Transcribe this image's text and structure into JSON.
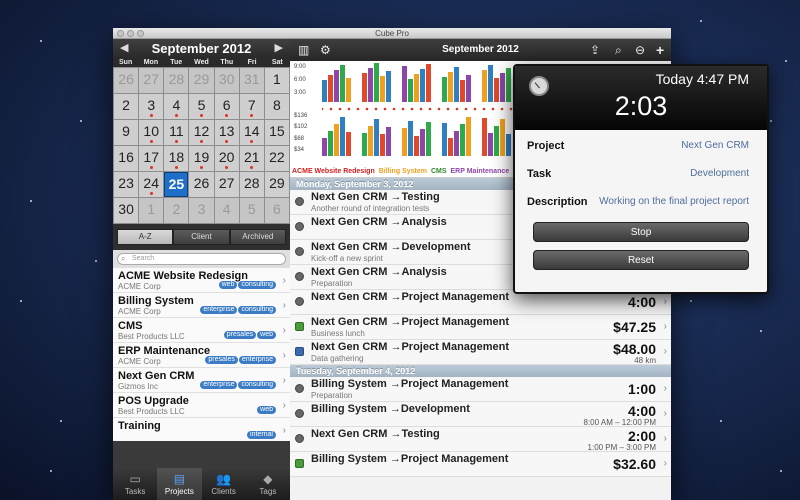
{
  "window": {
    "title": "Cube Pro"
  },
  "calendar": {
    "month": "September 2012",
    "prev_icon": "chevron-left-icon",
    "next_icon": "chevron-right-icon",
    "dows": [
      "Sun",
      "Mon",
      "Tue",
      "Wed",
      "Thu",
      "Fri",
      "Sat"
    ],
    "days": [
      {
        "d": "26",
        "dim": true,
        "dot": false
      },
      {
        "d": "27",
        "dim": true,
        "dot": false
      },
      {
        "d": "28",
        "dim": true,
        "dot": false
      },
      {
        "d": "29",
        "dim": true,
        "dot": false
      },
      {
        "d": "30",
        "dim": true,
        "dot": false
      },
      {
        "d": "31",
        "dim": true,
        "dot": false
      },
      {
        "d": "1",
        "dim": false,
        "dot": false
      },
      {
        "d": "2",
        "dim": false,
        "dot": false
      },
      {
        "d": "3",
        "dim": false,
        "dot": true
      },
      {
        "d": "4",
        "dim": false,
        "dot": true
      },
      {
        "d": "5",
        "dim": false,
        "dot": true
      },
      {
        "d": "6",
        "dim": false,
        "dot": true
      },
      {
        "d": "7",
        "dim": false,
        "dot": true
      },
      {
        "d": "8",
        "dim": false,
        "dot": false
      },
      {
        "d": "9",
        "dim": false,
        "dot": false
      },
      {
        "d": "10",
        "dim": false,
        "dot": true
      },
      {
        "d": "11",
        "dim": false,
        "dot": true
      },
      {
        "d": "12",
        "dim": false,
        "dot": true
      },
      {
        "d": "13",
        "dim": false,
        "dot": true
      },
      {
        "d": "14",
        "dim": false,
        "dot": true
      },
      {
        "d": "15",
        "dim": false,
        "dot": false
      },
      {
        "d": "16",
        "dim": false,
        "dot": false
      },
      {
        "d": "17",
        "dim": false,
        "dot": true
      },
      {
        "d": "18",
        "dim": false,
        "dot": true
      },
      {
        "d": "19",
        "dim": false,
        "dot": true
      },
      {
        "d": "20",
        "dim": false,
        "dot": true
      },
      {
        "d": "21",
        "dim": false,
        "dot": true
      },
      {
        "d": "22",
        "dim": false,
        "dot": false
      },
      {
        "d": "23",
        "dim": false,
        "dot": false
      },
      {
        "d": "24",
        "dim": false,
        "dot": true
      },
      {
        "d": "25",
        "dim": false,
        "dot": false,
        "selected": true
      },
      {
        "d": "26",
        "dim": false,
        "dot": false
      },
      {
        "d": "27",
        "dim": false,
        "dot": false
      },
      {
        "d": "28",
        "dim": false,
        "dot": false
      },
      {
        "d": "29",
        "dim": false,
        "dot": false
      },
      {
        "d": "30",
        "dim": false,
        "dot": false
      },
      {
        "d": "1",
        "dim": true,
        "dot": false
      },
      {
        "d": "2",
        "dim": true,
        "dot": false
      },
      {
        "d": "3",
        "dim": true,
        "dot": false
      },
      {
        "d": "4",
        "dim": true,
        "dot": false
      },
      {
        "d": "5",
        "dim": true,
        "dot": false
      },
      {
        "d": "6",
        "dim": true,
        "dot": false
      }
    ]
  },
  "segments": [
    "A-Z",
    "Client",
    "Archived"
  ],
  "search": {
    "placeholder": "Search"
  },
  "projects": [
    {
      "name": "ACME Website Redesign",
      "client": "ACME Corp",
      "tags": [
        "web",
        "consulting"
      ]
    },
    {
      "name": "Billing System",
      "client": "ACME Corp",
      "tags": [
        "enterprise",
        "consulting"
      ]
    },
    {
      "name": "CMS",
      "client": "Best Products LLC",
      "tags": [
        "presales",
        "web"
      ]
    },
    {
      "name": "ERP Maintenance",
      "client": "ACME Corp",
      "tags": [
        "presales",
        "enterprise"
      ]
    },
    {
      "name": "Next Gen CRM",
      "client": "Gizmos Inc",
      "tags": [
        "enterprise",
        "consulting"
      ]
    },
    {
      "name": "POS Upgrade",
      "client": "Best Products LLC",
      "tags": [
        "web"
      ]
    },
    {
      "name": "Training",
      "client": "",
      "tags": [
        "internal"
      ]
    }
  ],
  "tabs": [
    {
      "label": "Tasks",
      "icon": "tray-icon"
    },
    {
      "label": "Projects",
      "icon": "folder-icon",
      "active": true
    },
    {
      "label": "Clients",
      "icon": "people-icon"
    },
    {
      "label": "Tags",
      "icon": "tag-icon"
    }
  ],
  "toolbar": {
    "title": "September 2012"
  },
  "chart_data": {
    "type": "bar",
    "title": "",
    "series_colors": [
      "#2f7fc1",
      "#e04a2a",
      "#8d47a7",
      "#2eaa4a",
      "#f0a020"
    ],
    "time_axis": {
      "ticks": [
        "9:00",
        "6:00",
        "3:00"
      ]
    },
    "money_axis": {
      "ticks": [
        "$136",
        "$102",
        "$68",
        "$34"
      ]
    },
    "legend": [
      {
        "name": "ACME Website Redesign",
        "color": "#d02020"
      },
      {
        "name": "Billing System",
        "color": "#f0a020"
      },
      {
        "name": "CMS",
        "color": "#2e8a2e"
      },
      {
        "name": "ERP Maintenance",
        "color": "#8d47a7"
      }
    ]
  },
  "sections": [
    {
      "date": "Monday, September 3, 2012",
      "entries": [
        {
          "title": "Next Gen CRM →Testing",
          "sub": "Another round of integration tests",
          "value": "",
          "value_sub": "",
          "kind": "time"
        },
        {
          "title": "Next Gen CRM →Analysis",
          "sub": "",
          "value": "",
          "value_sub": "",
          "kind": "time"
        },
        {
          "title": "Next Gen CRM →Development",
          "sub": "Kick-off a new sprint",
          "value": "",
          "value_sub": "",
          "kind": "time"
        },
        {
          "title": "Next Gen CRM →Analysis",
          "sub": "Preparation",
          "value": "",
          "value_sub": "",
          "kind": "time"
        },
        {
          "title": "Next Gen CRM →Project Management",
          "sub": "",
          "value": "4:00",
          "value_sub": "",
          "kind": "time"
        },
        {
          "title": "Next Gen CRM →Project Management",
          "sub": "Business lunch",
          "value": "$47.25",
          "value_sub": "",
          "kind": "money"
        },
        {
          "title": "Next Gen CRM →Project Management",
          "sub": "Data gathering",
          "value": "$48.00",
          "value_sub": "48 km",
          "kind": "car"
        }
      ]
    },
    {
      "date": "Tuesday, September 4, 2012",
      "entries": [
        {
          "title": "Billing System →Project Management",
          "sub": "Preparation",
          "value": "1:00",
          "value_sub": "",
          "kind": "time"
        },
        {
          "title": "Billing System →Development",
          "sub": "",
          "value": "4:00",
          "value_sub": "8:00 AM – 12:00 PM",
          "kind": "time"
        },
        {
          "title": "Next Gen CRM →Testing",
          "sub": "",
          "value": "2:00",
          "value_sub": "1:00 PM – 3:00 PM",
          "kind": "time"
        },
        {
          "title": "Billing System →Project Management",
          "sub": "",
          "value": "$32.60",
          "value_sub": "",
          "kind": "money"
        }
      ]
    }
  ],
  "timer": {
    "today": "Today 4:47 PM",
    "elapsed": "2:03",
    "project_label": "Project",
    "project": "Next Gen CRM",
    "task_label": "Task",
    "task": "Development",
    "description_label": "Description",
    "description": "Working on the final project report",
    "stop": "Stop",
    "reset": "Reset"
  }
}
